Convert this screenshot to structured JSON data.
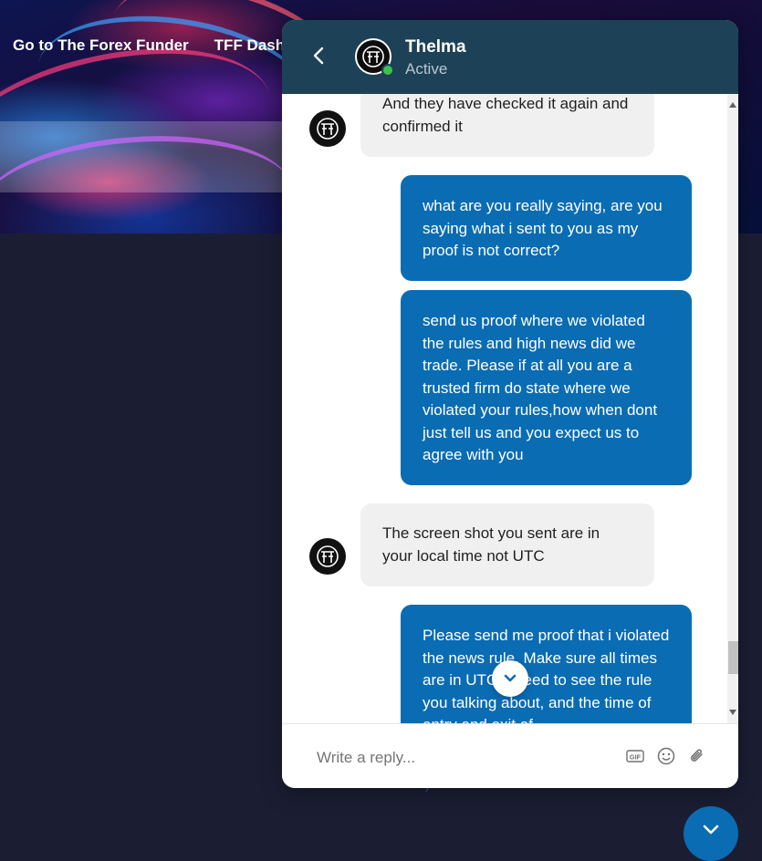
{
  "nav": {
    "items": [
      "Go to The Forex Funder",
      "TFF Dashboard"
    ]
  },
  "chat": {
    "agent_name": "Thelma",
    "agent_status": "Active",
    "messages": [
      {
        "from": "agent",
        "text": "And they have checked it again and confirmed it"
      },
      {
        "from": "user",
        "text": "what are you really saying, are you saying what i sent to you as my proof is not correct?"
      },
      {
        "from": "user",
        "text": "send us proof where we violated the rules and high news did we trade. Please if at all you are a trusted firm do state where we violated your rules,how when dont just tell us and you expect us to agree with you"
      },
      {
        "from": "agent",
        "text": "The screen shot you sent are in your local time not UTC"
      },
      {
        "from": "user",
        "text": "Please send me proof that i violated the news rule. Make sure all times are in UTC. I need to see the rule you talking about, and the time of entry and exit of"
      }
    ],
    "composer": {
      "placeholder": "Write a reply...",
      "icons": [
        "gif-icon",
        "emoji-icon",
        "attachment-icon"
      ]
    }
  },
  "colors": {
    "header": "#1d4156",
    "outgoing_bubble": "#0a6cb3",
    "incoming_bubble": "#f0f0f0",
    "online": "#3cc24a"
  }
}
